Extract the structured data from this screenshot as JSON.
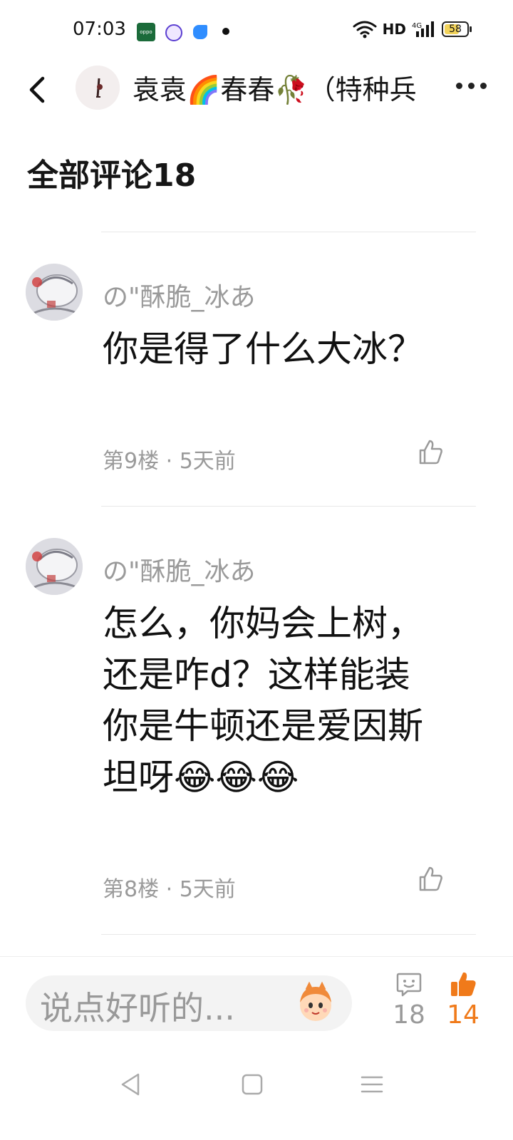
{
  "status": {
    "time": "07:03",
    "network": "HD",
    "battery": "58"
  },
  "header": {
    "title": "袁袁🌈春春🥀（特种兵"
  },
  "section": {
    "title": "全部评论18"
  },
  "comments": [
    {
      "user": "の\"酥脆_冰あ",
      "text": "你是得了什么大冰？",
      "meta": "第9楼 · 5天前"
    },
    {
      "user": "の\"酥脆_冰あ",
      "text": "怎么，你妈会上树，还是咋d？这样能装 你是牛顿还是爱因斯坦呀😂😂😂",
      "meta": "第8楼 · 5天前"
    }
  ],
  "bottom": {
    "input_placeholder": "说点好听的...",
    "comment_count": "18",
    "like_count": "14"
  },
  "colors": {
    "accent": "#f07a1a",
    "muted": "#9a9a9a"
  }
}
